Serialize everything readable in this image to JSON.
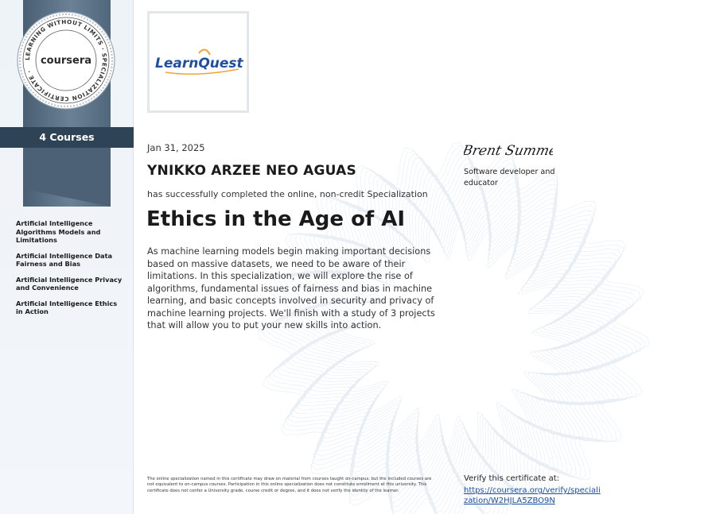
{
  "sidebar": {
    "seal": {
      "ring_text": "LEARNING WITHOUT LIMITS · SPECIALIZATION CERTIFICATE ·",
      "brand": "coursera"
    },
    "courses_count": "4 Courses",
    "courses": [
      "Artificial Intelligence Algorithms Models and Limitations",
      "Artificial Intelligence Data Fairness and Bias",
      "Artificial Intelligence Privacy and Convenience",
      "Artificial Intelligence Ethics in Action"
    ]
  },
  "certificate": {
    "partner_logo": {
      "part1": "Learn",
      "part2": "Quest",
      "color": "#1f4fa3",
      "accent": "#f3a23a"
    },
    "date": "Jan 31, 2025",
    "learner_name": "YNIKKO ARZEE NEO AGUAS",
    "completion_text": "has successfully completed the online, non-credit Specialization",
    "title": "Ethics in the Age of AI",
    "description": "As machine learning models begin making important decisions based on massive datasets, we need to be aware of their limitations. In this specialization, we will explore the rise of algorithms, fundamental issues of fairness and bias in machine learning, and basic concepts involved in security and privacy of machine learning projects. We'll finish with a study of 3 projects that will allow you to put your new skills into action.",
    "signature": {
      "name": "Brent Summers",
      "role": "Software developer and educator"
    },
    "disclaimer": "The online specialization named in this certificate may draw on material from courses taught on-campus, but the included courses are not equivalent to on-campus courses. Participation in this online specialization does not constitute enrollment at this university. This certificate does not confer a University grade, course credit or degree, and it does not verify the identity of the learner.",
    "verify": {
      "label": "Verify this certificate at:",
      "url": "https://coursera.org/verify/specialization/W2HJLA5ZBO9N"
    }
  },
  "colors": {
    "sidebar_band": "#2f4356",
    "ribbon": "#5a6f84",
    "link": "#1a4fa8"
  }
}
